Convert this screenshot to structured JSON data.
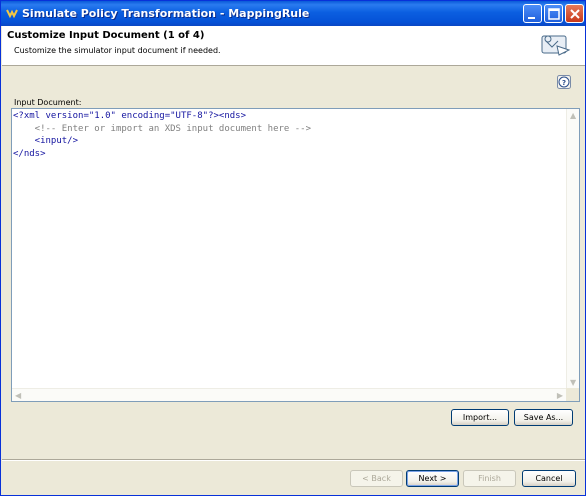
{
  "window": {
    "title": "Simulate Policy Transformation - MappingRule"
  },
  "banner": {
    "title": "Customize Input Document (1 of 4)",
    "description": "Customize the simulator input document if needed."
  },
  "help": {
    "glyph": "?"
  },
  "input_document": {
    "label": "Input Document:",
    "lines": [
      {
        "text": "<?xml version=\"1.0\" encoding=\"UTF-8\"?><nds>",
        "kind": "tag"
      },
      {
        "text": "    <!-- Enter or import an XDS input document here -->",
        "kind": "comment"
      },
      {
        "text": "    <input/>",
        "kind": "tag"
      },
      {
        "text": "</nds>",
        "kind": "tag"
      }
    ]
  },
  "actions": {
    "import_label": "Import...",
    "save_as_label": "Save As..."
  },
  "footer": {
    "back_label": "< Back",
    "next_label": "Next >",
    "finish_label": "Finish",
    "cancel_label": "Cancel"
  },
  "icons": {
    "app": "app-icon",
    "minimize": "minimize-icon",
    "maximize": "maximize-icon",
    "close": "close-icon",
    "wizard": "wizard-icon",
    "help": "help-icon"
  }
}
